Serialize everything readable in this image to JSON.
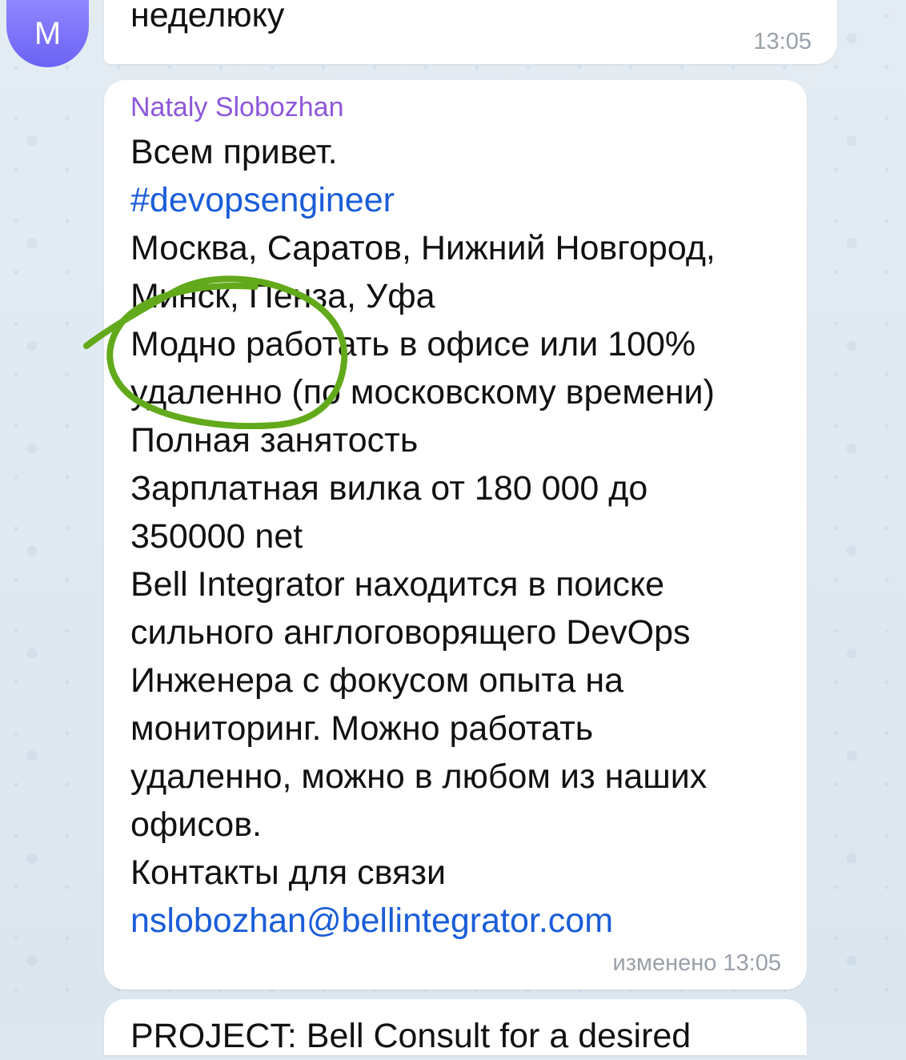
{
  "chat": {
    "avatar_initial": "M",
    "top_message": {
      "text": "неделюку",
      "time": "13:05"
    },
    "main_message": {
      "sender": "Nataly Slobozhan",
      "lines": [
        {
          "text": "Всем привет."
        },
        {
          "text": "#devopsengineer"
        },
        {
          "text": "Москва, Саратов, Нижний Новгород,"
        },
        {
          "text": "Минск, Пенза, Уфа"
        },
        {
          "text": "Модно работать в офисе или 100%"
        },
        {
          "text": "удаленно (по московскому времени)"
        },
        {
          "text": "Полная занятость"
        },
        {
          "text": "Зарплатная вилка от 180 000 до"
        },
        {
          "text": "350000 net"
        },
        {
          "text": "Bell Integrator находится в поиске"
        },
        {
          "text": "сильного англоговорящего DevOps"
        },
        {
          "text": "Инженера с фокусом опыта на"
        },
        {
          "text": "мониторинг. Можно работать"
        },
        {
          "text": "удаленно, можно в любом из наших"
        },
        {
          "text": "офисов."
        },
        {
          "text": "Контакты для связи"
        },
        {
          "text": "nslobozhan@bellintegrator.com"
        }
      ],
      "edited_time": "изменено 13:05"
    },
    "next_message_preview": "PROJECT: Bell Consult for a desired"
  },
  "colors": {
    "sender": "#8d58d9",
    "link": "#1a5dd8",
    "annotation": "#62a91b",
    "avatar": "#7b72ff"
  },
  "icons": {
    "annotation_mark": "hand-drawn-circle-icon"
  }
}
